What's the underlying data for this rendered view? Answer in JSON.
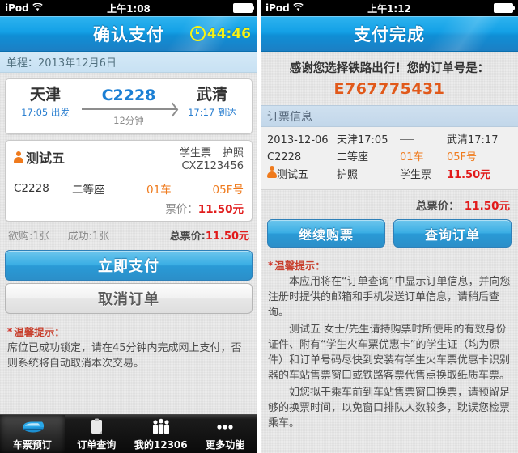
{
  "left": {
    "statusbar": {
      "carrier": "iPod",
      "time": "上午1:08",
      "wifi_icon": "wifi-icon",
      "battery_icon": "battery-icon"
    },
    "navbar": {
      "title": "确认支付",
      "timer": "44:46",
      "timer_icon": "clock-icon"
    },
    "datebar": {
      "text": "单程：2013年12月6日"
    },
    "route": {
      "from_city": "天津",
      "from_time": "17:05 出发",
      "train_no": "C2228",
      "duration": "12分钟",
      "to_city": "武清",
      "to_time": "17:17 到达"
    },
    "passenger": {
      "name": "测试五",
      "person_icon": "person-icon",
      "ticket_type": "学生票",
      "id_type": "护照",
      "id_number": "CXZ123456",
      "train_no": "C2228",
      "seat_class": "二等座",
      "carriage": "01车",
      "seat": "05F号",
      "fare_label": "票价：",
      "fare_value": "11.50元"
    },
    "totals": {
      "wanted": "欲购:1张",
      "success": "成功:1张",
      "total_label": "总票价:",
      "total_value": "11.50元"
    },
    "buttons": {
      "pay": "立即支付",
      "cancel": "取消订单"
    },
    "tips": {
      "star": "*",
      "heading": "温馨提示：",
      "paragraphs": [
        "席位已成功锁定，请在45分钟内完成网上支付，否则系统将自动取消本次交易。"
      ]
    },
    "tabbar": [
      {
        "label": "车票预订",
        "icon": "train-icon",
        "active": true
      },
      {
        "label": "订单查询",
        "icon": "clipboard-icon",
        "active": false
      },
      {
        "label": "我的12306",
        "icon": "people-icon",
        "active": false
      },
      {
        "label": "更多功能",
        "icon": "more-dots-icon",
        "active": false
      }
    ]
  },
  "right": {
    "statusbar": {
      "carrier": "iPod",
      "time": "上午1:12",
      "wifi_icon": "wifi-icon",
      "battery_icon": "battery-icon"
    },
    "navbar": {
      "title": "支付完成"
    },
    "thanks": "感谢您选择铁路出行！您的订单号是：",
    "order_number": "E767775431",
    "section_title": "订票信息",
    "info": {
      "date": "2013-12-06",
      "from": "天津17:05",
      "to": "武清17:17",
      "train_no": "C2228",
      "seat_class": "二等座",
      "carriage": "01车",
      "seat": "05F号",
      "person_icon": "person-icon",
      "name": "测试五",
      "id_type": "护照",
      "ticket_type": "学生票",
      "fare": "11.50元"
    },
    "total": {
      "label": "总票价：",
      "value": "11.50元"
    },
    "buttons": {
      "continue": "继续购票",
      "query": "查询订单"
    },
    "tips": {
      "star": "*",
      "heading": "温馨提示：",
      "paragraphs": [
        "本应用将在“订单查询”中显示订单信息，并向您注册时提供的邮箱和手机发送订单信息，请稍后查询。",
        "测试五 女士/先生请持购票时所使用的有效身份证件、附有“学生火车票优惠卡”的学生证（均为原件）和订单号码尽快到安装有学生火车票优惠卡识别器的车站售票窗口或铁路客票代售点换取纸质车票。",
        "如您拟于乘车前到车站售票窗口换票，请预留足够的换票时间，以免窗口排队人数较多，耽误您检票乘车。"
      ]
    }
  }
}
